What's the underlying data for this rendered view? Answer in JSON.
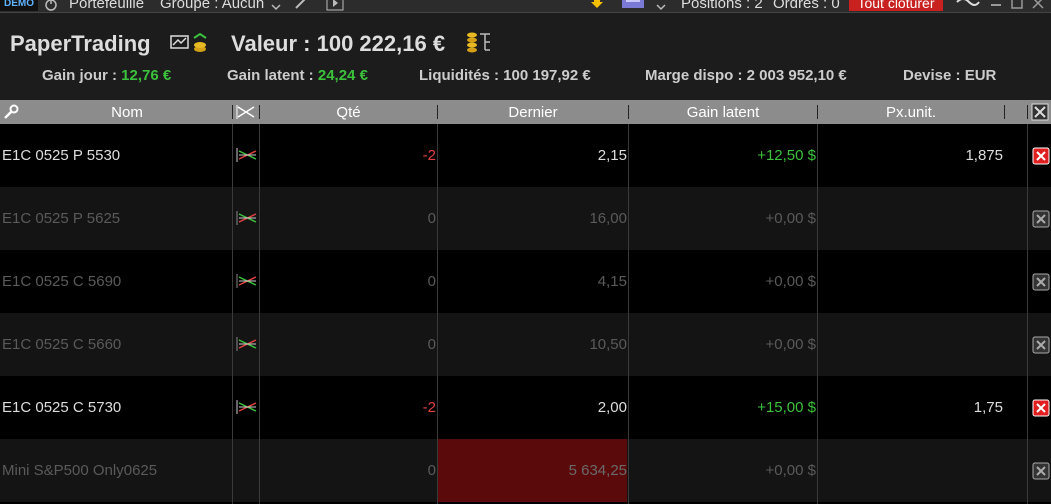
{
  "topbar": {
    "demo": "DEMO",
    "portfolio_label": "Portefeuille",
    "group_label": "Groupe : Aucun",
    "positions": "Positions : 2",
    "orders": "Ordres : 0",
    "close_all": "Tout clôturer"
  },
  "header": {
    "brand": "PaperTrading",
    "value": "Valeur : 100 222,16 €",
    "gain_jour_label": "Gain jour :",
    "gain_jour_value": "12,76 €",
    "gain_latent_label": "Gain latent :",
    "gain_latent_value": "24,24 €",
    "liquidites": "Liquidités : 100 197,92 €",
    "marge": "Marge dispo : 2 003 952,10 €",
    "devise": "Devise : EUR"
  },
  "columns": {
    "nom": "Nom",
    "qte": "Qté",
    "dernier": "Dernier",
    "gain_latent": "Gain latent",
    "px_unit": "Px.unit."
  },
  "rows": [
    {
      "nom": "E1C 0525 P 5530",
      "qte": "-2",
      "dernier": "2,15",
      "gain": "+12,50 $",
      "px": "1,875",
      "active": true
    },
    {
      "nom": "E1C 0525 P 5625",
      "qte": "0",
      "dernier": "16,00",
      "gain": "+0,00 $",
      "px": "",
      "active": false
    },
    {
      "nom": "E1C 0525 C 5690",
      "qte": "0",
      "dernier": "4,15",
      "gain": "+0,00 $",
      "px": "",
      "active": false
    },
    {
      "nom": "E1C 0525 C 5660",
      "qte": "0",
      "dernier": "10,50",
      "gain": "+0,00 $",
      "px": "",
      "active": false
    },
    {
      "nom": "E1C 0525 C 5730",
      "qte": "-2",
      "dernier": "2,00",
      "gain": "+15,00 $",
      "px": "1,75",
      "active": true
    },
    {
      "nom": "Mini S&P500 Only0625",
      "qte": "0",
      "dernier": "5 634,25",
      "gain": "+0,00 $",
      "px": "",
      "active": false
    }
  ],
  "colors": {
    "row_even": "#000000",
    "row_odd": "#141414",
    "highlight": "#5a0a0a",
    "green": "#3cc13c",
    "red": "#e04040"
  }
}
